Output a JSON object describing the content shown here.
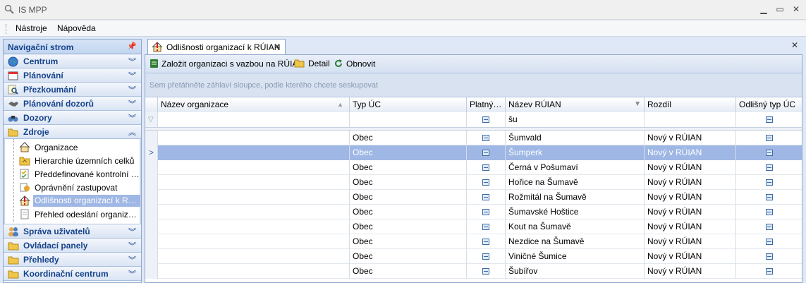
{
  "window": {
    "title": "IS MPP"
  },
  "menu": [
    "Nástroje",
    "Nápověda"
  ],
  "nav": {
    "title": "Navigační strom",
    "groups_top": [
      {
        "label": "Centrum",
        "icon": "globe-icon"
      },
      {
        "label": "Plánování",
        "icon": "calendar-icon"
      },
      {
        "label": "Přezkoumání",
        "icon": "magnifier-icon"
      },
      {
        "label": "Plánování dozorů",
        "icon": "handshake-icon"
      },
      {
        "label": "Dozory",
        "icon": "binoculars-icon"
      },
      {
        "label": "Zdroje",
        "icon": "folder-icon"
      }
    ],
    "zdroje_items": [
      "Organizace",
      "Hierarchie územních celků",
      "Předdefinované kontrolní s…",
      "Oprávnění zastupovat",
      "Odlišnosti organizací k RÚIAN",
      "Přehled odeslání organizací …"
    ],
    "groups_bottom": [
      {
        "label": "Správa uživatelů",
        "icon": "users-icon"
      },
      {
        "label": "Ovládací panely",
        "icon": "panels-icon"
      },
      {
        "label": "Přehledy",
        "icon": "report-icon"
      },
      {
        "label": "Koordinační centrum",
        "icon": "coordination-icon"
      }
    ]
  },
  "tab": {
    "label": "Odlišnosti organizací k RÚIAN"
  },
  "toolbar": {
    "create": "Založit organizaci s vazbou na RÚIAN",
    "detail": "Detail",
    "refresh": "Obnovit"
  },
  "group_hint": "Sem přetáhněte záhlaví sloupce, podle kterého chcete seskupovat",
  "columns": [
    "Název organizace",
    "Typ ÚC",
    "Platný…",
    "Název RÚIAN",
    "Rozdíl",
    "Odlišný typ ÚC"
  ],
  "filter": {
    "nazev_ruian": "šu"
  },
  "rows": [
    {
      "typ": "Obec",
      "ruian": "Šumvald",
      "rozdil": "Nový v RÚIAN"
    },
    {
      "typ": "Obec",
      "ruian": "Šumperk",
      "rozdil": "Nový v RÚIAN"
    },
    {
      "typ": "Obec",
      "ruian": "Černá v Pošumaví",
      "rozdil": "Nový v RÚIAN"
    },
    {
      "typ": "Obec",
      "ruian": "Hořice na Šumavě",
      "rozdil": "Nový v RÚIAN"
    },
    {
      "typ": "Obec",
      "ruian": "Rožmitál na Šumavě",
      "rozdil": "Nový v RÚIAN"
    },
    {
      "typ": "Obec",
      "ruian": "Šumavské Hoštice",
      "rozdil": "Nový v RÚIAN"
    },
    {
      "typ": "Obec",
      "ruian": "Kout na Šumavě",
      "rozdil": "Nový v RÚIAN"
    },
    {
      "typ": "Obec",
      "ruian": "Nezdice na Šumavě",
      "rozdil": "Nový v RÚIAN"
    },
    {
      "typ": "Obec",
      "ruian": "Viničné Šumice",
      "rozdil": "Nový v RÚIAN"
    },
    {
      "typ": "Obec",
      "ruian": "Šubířov",
      "rozdil": "Nový v RÚIAN"
    }
  ]
}
